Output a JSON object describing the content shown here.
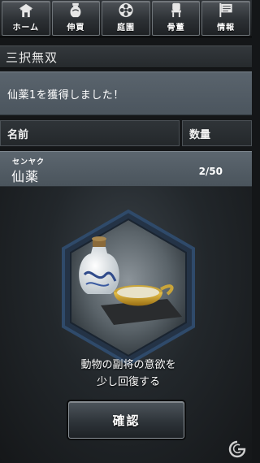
{
  "nav": {
    "items": [
      {
        "label": "ホーム",
        "icon": "home-icon"
      },
      {
        "label": "伸買",
        "icon": "vase-icon"
      },
      {
        "label": "庭園",
        "icon": "flower-icon"
      },
      {
        "label": "骨董",
        "icon": "chair-icon"
      },
      {
        "label": "情報",
        "icon": "flag-icon"
      }
    ]
  },
  "title": "三択無双",
  "message": "仙薬1を獲得しました！",
  "table": {
    "headers": {
      "name": "名前",
      "quantity": "数量"
    },
    "rows": [
      {
        "ruby": "センヤク",
        "name": "仙薬",
        "quantity": "2/50"
      }
    ]
  },
  "detail": {
    "description_line1": "動物の副将の意欲を",
    "description_line2": "少し回復する",
    "confirm_label": "確認"
  },
  "colors": {
    "background": "#141618",
    "message_band": "#56606a",
    "hex_border": "#2f4a6a"
  }
}
